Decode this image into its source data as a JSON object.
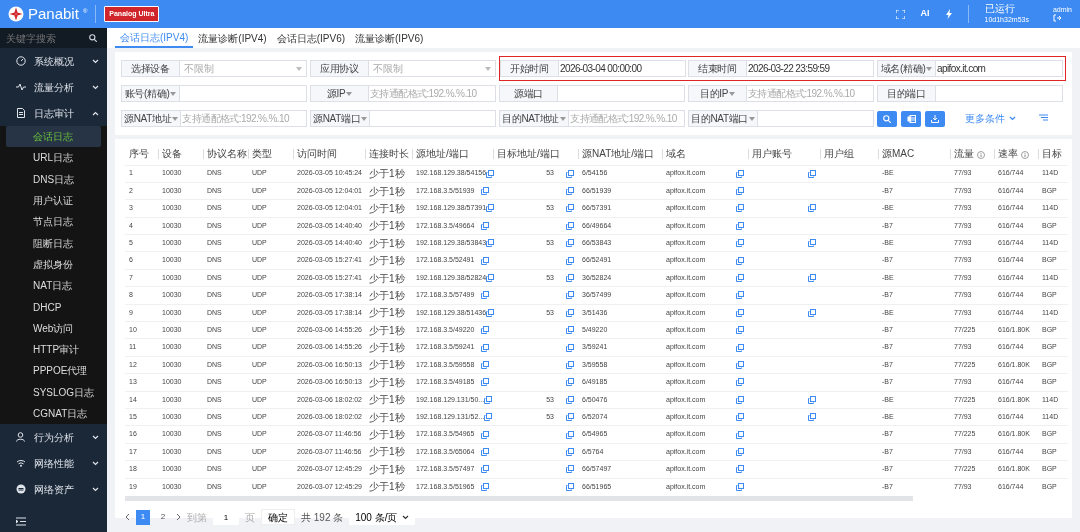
{
  "header": {
    "brand": "Panabit",
    "brand_mark": "®",
    "product": "Panalog Ultra",
    "ai_label": "AI",
    "uptime_label": "已运行",
    "uptime": "10d1h32m53s",
    "user": "admin"
  },
  "sidebar": {
    "search_placeholder": "关键字搜索",
    "items": [
      {
        "label": "系统概况",
        "expanded": false
      },
      {
        "label": "流量分析",
        "expanded": false
      },
      {
        "label": "日志审计",
        "expanded": true,
        "children": [
          {
            "label": "会话日志",
            "selected": true
          },
          {
            "label": "URL日志",
            "selected": false
          },
          {
            "label": "DNS日志",
            "selected": false
          },
          {
            "label": "用户认证",
            "selected": false
          },
          {
            "label": "节点日志",
            "selected": false
          },
          {
            "label": "阻断日志",
            "selected": false
          },
          {
            "label": "虚拟身份",
            "selected": false
          },
          {
            "label": "NAT日志",
            "selected": false
          },
          {
            "label": "DHCP",
            "selected": false
          },
          {
            "label": "Web访问",
            "selected": false
          },
          {
            "label": "HTTP审计",
            "selected": false
          },
          {
            "label": "PPPOE代理",
            "selected": false
          },
          {
            "label": "SYSLOG日志",
            "selected": false
          },
          {
            "label": "CGNAT日志",
            "selected": false
          }
        ]
      },
      {
        "label": "行为分析",
        "expanded": false
      },
      {
        "label": "网络性能",
        "expanded": false
      },
      {
        "label": "网络资产",
        "expanded": false
      }
    ]
  },
  "tabs": [
    {
      "label": "会话日志(IPV4)",
      "selected": true
    },
    {
      "label": "流量诊断(IPV4)",
      "selected": false
    },
    {
      "label": "会话日志(IPV6)",
      "selected": false
    },
    {
      "label": "流量诊断(IPV6)",
      "selected": false
    }
  ],
  "filters": [
    {
      "label": "选择设备",
      "dropdown": false,
      "kind": "select",
      "placeholder": "不限制",
      "highlighted": false
    },
    {
      "label": "应用协议",
      "dropdown": false,
      "kind": "select",
      "placeholder": "不限制",
      "highlighted": false
    },
    {
      "label": "开始时间",
      "dropdown": false,
      "kind": "input",
      "value": "2026-03-04 00:00:00",
      "highlighted": true
    },
    {
      "label": "结束时间",
      "dropdown": false,
      "kind": "input",
      "value": "2026-03-22 23:59:59",
      "highlighted": true
    },
    {
      "label": "域名(精确)",
      "dropdown": true,
      "kind": "input",
      "value": "apifox.it.com",
      "highlighted": true
    },
    {
      "label": "账号(精确)",
      "dropdown": true,
      "kind": "input",
      "highlighted": false
    },
    {
      "label": "源IP",
      "dropdown": true,
      "kind": "input",
      "placeholder": "支持通配格式:192.%.%.10",
      "highlighted": false
    },
    {
      "label": "源端口",
      "dropdown": false,
      "kind": "input",
      "highlighted": false
    },
    {
      "label": "目的IP",
      "dropdown": true,
      "kind": "input",
      "placeholder": "支持通配格式:192.%.%.10",
      "highlighted": false
    },
    {
      "label": "目的端口",
      "dropdown": false,
      "kind": "input",
      "highlighted": false
    },
    {
      "label": "源NAT地址",
      "dropdown": true,
      "kind": "input",
      "placeholder": "支持通配格式:192.%.%.10",
      "highlighted": false
    },
    {
      "label": "源NAT端口",
      "dropdown": true,
      "kind": "input",
      "highlighted": false
    },
    {
      "label": "目的NAT地址",
      "dropdown": true,
      "kind": "input",
      "placeholder": "支持通配格式:192.%.%.10",
      "highlighted": false
    },
    {
      "label": "目的NAT端口",
      "dropdown": true,
      "kind": "input",
      "highlighted": false
    }
  ],
  "more_conditions": "更多条件",
  "table": {
    "columns": [
      {
        "label": "序号"
      },
      {
        "label": "设备"
      },
      {
        "label": "协议名称"
      },
      {
        "label": "类型"
      },
      {
        "label": "访问时间"
      },
      {
        "label": "连接时长"
      },
      {
        "label": "源地址/端口",
        "copy": true
      },
      {
        "label": "目标地址/端口",
        "copy": true
      },
      {
        "label": "源NAT地址/端口"
      },
      {
        "label": "域名",
        "copy": true
      },
      {
        "label": "用户账号"
      },
      {
        "label": "用户组"
      },
      {
        "label": "源MAC"
      },
      {
        "label": "流量",
        "info": true
      },
      {
        "label": "速率",
        "info": true
      },
      {
        "label": "目标"
      }
    ],
    "rows": [
      {
        "cells": [
          "1",
          "10030",
          "DNS",
          "UDP",
          "2026-03-05 10:45:24",
          "少于1秒",
          "192.168.129.38/54156",
          "53",
          "6/54156",
          "apifox.it.com",
          null,
          null,
          "-BE",
          "77/93",
          "616/744",
          "114D"
        ],
        "user_copy": true
      },
      {
        "cells": [
          "2",
          "10030",
          "DNS",
          "UDP",
          "2026-03-05 12:04:01",
          "少于1秒",
          "172.168.3.5/51939",
          null,
          "66/51939",
          "apifox.it.com",
          null,
          null,
          "-B7",
          "77/93",
          "616/744",
          "BGP"
        ],
        "user_copy": false
      },
      {
        "cells": [
          "3",
          "10030",
          "DNS",
          "UDP",
          "2026-03-05 12:04:01",
          "少于1秒",
          "192.168.129.38/57391",
          "53",
          "66/57391",
          "apifox.it.com",
          null,
          null,
          "-BE",
          "77/93",
          "616/744",
          "114D"
        ],
        "user_copy": true
      },
      {
        "cells": [
          "4",
          "10030",
          "DNS",
          "UDP",
          "2026-03-05 14:40:40",
          "少于1秒",
          "172.168.3.5/49664",
          null,
          "66/49664",
          "apifox.it.com",
          null,
          null,
          "-B7",
          "77/93",
          "616/744",
          "BGP"
        ],
        "user_copy": false
      },
      {
        "cells": [
          "5",
          "10030",
          "DNS",
          "UDP",
          "2026-03-05 14:40:40",
          "少于1秒",
          "192.168.129.38/53843",
          "53",
          "66/53843",
          "apifox.it.com",
          null,
          null,
          "-BE",
          "77/93",
          "616/744",
          "114D"
        ],
        "user_copy": true
      },
      {
        "cells": [
          "6",
          "10030",
          "DNS",
          "UDP",
          "2026-03-05 15:27:41",
          "少于1秒",
          "172.168.3.5/52491",
          null,
          "66/52491",
          "apifox.it.com",
          null,
          null,
          "-B7",
          "77/93",
          "616/744",
          "BGP"
        ],
        "user_copy": false
      },
      {
        "cells": [
          "7",
          "10030",
          "DNS",
          "UDP",
          "2026-03-05 15:27:41",
          "少于1秒",
          "192.168.129.38/52824",
          "53",
          "36/52824",
          "apifox.it.com",
          null,
          null,
          "-BE",
          "77/93",
          "616/744",
          "114D"
        ],
        "user_copy": true
      },
      {
        "cells": [
          "8",
          "10030",
          "DNS",
          "UDP",
          "2026-03-05 17:38:14",
          "少于1秒",
          "172.168.3.5/57499",
          null,
          "36/57499",
          "apifox.it.com",
          null,
          null,
          "-B7",
          "77/93",
          "616/744",
          "BGP"
        ],
        "user_copy": false
      },
      {
        "cells": [
          "9",
          "10030",
          "DNS",
          "UDP",
          "2026-03-05 17:38:14",
          "少于1秒",
          "192.168.129.38/51436",
          "53",
          "3/51436",
          "apifox.it.com",
          null,
          null,
          "-BE",
          "77/93",
          "616/744",
          "114D"
        ],
        "user_copy": true
      },
      {
        "cells": [
          "10",
          "10030",
          "DNS",
          "UDP",
          "2026-03-06 14:55:26",
          "少于1秒",
          "172.168.3.5/49220",
          null,
          "5/49220",
          "apifox.it.com",
          null,
          null,
          "-B7",
          "77/225",
          "616/1.80K",
          "BGP"
        ],
        "user_copy": false
      },
      {
        "cells": [
          "11",
          "10030",
          "DNS",
          "UDP",
          "2026-03-06 14:55:26",
          "少于1秒",
          "172.168.3.5/59241",
          null,
          "3/59241",
          "apifox.it.com",
          null,
          null,
          "-B7",
          "77/93",
          "616/744",
          "BGP"
        ],
        "user_copy": false
      },
      {
        "cells": [
          "12",
          "10030",
          "DNS",
          "UDP",
          "2026-03-06 16:50:13",
          "少于1秒",
          "172.168.3.5/59558",
          null,
          "3/59558",
          "apifox.it.com",
          null,
          null,
          "-B7",
          "77/225",
          "616/1.80K",
          "BGP"
        ],
        "user_copy": false
      },
      {
        "cells": [
          "13",
          "10030",
          "DNS",
          "UDP",
          "2026-03-06 16:50:13",
          "少于1秒",
          "172.168.3.5/49185",
          null,
          "6/49185",
          "apifox.it.com",
          null,
          null,
          "-B7",
          "77/93",
          "616/744",
          "BGP"
        ],
        "user_copy": false
      },
      {
        "cells": [
          "14",
          "10030",
          "DNS",
          "UDP",
          "2026-03-06 18:02:02",
          "少于1秒",
          "192.168.129.131/50...",
          "53",
          "6/50476",
          "apifox.it.com",
          null,
          null,
          "-BE",
          "77/225",
          "616/1.80K",
          "114D"
        ],
        "user_copy": true
      },
      {
        "cells": [
          "15",
          "10030",
          "DNS",
          "UDP",
          "2026-03-06 18:02:02",
          "少于1秒",
          "192.168.129.131/52...",
          "53",
          "6/52074",
          "apifox.it.com",
          null,
          null,
          "-BE",
          "77/93",
          "616/744",
          "114D"
        ],
        "user_copy": true
      },
      {
        "cells": [
          "16",
          "10030",
          "DNS",
          "UDP",
          "2026-03-07 11:46:56",
          "少于1秒",
          "172.168.3.5/54965",
          null,
          "6/54965",
          "apifox.it.com",
          null,
          null,
          "-B7",
          "77/225",
          "616/1.80K",
          "BGP"
        ],
        "user_copy": false
      },
      {
        "cells": [
          "17",
          "10030",
          "DNS",
          "UDP",
          "2026-03-07 11:46:56",
          "少于1秒",
          "172.168.3.5/65064",
          null,
          "6/5764",
          "apifox.it.com",
          null,
          null,
          "-B7",
          "77/93",
          "616/744",
          "BGP"
        ],
        "user_copy": false
      },
      {
        "cells": [
          "18",
          "10030",
          "DNS",
          "UDP",
          "2026-03-07 12:45:29",
          "少于1秒",
          "172.168.3.5/57497",
          null,
          "66/57497",
          "apifox.it.com",
          null,
          null,
          "-B7",
          "77/225",
          "616/1.80K",
          "BGP"
        ],
        "user_copy": false
      },
      {
        "cells": [
          "19",
          "10030",
          "DNS",
          "UDP",
          "2026-03-07 12:45:29",
          "少于1秒",
          "172.168.3.5/51965",
          null,
          "66/51965",
          "apifox.it.com",
          null,
          null,
          "-B7",
          "77/93",
          "616/744",
          "BGP"
        ],
        "user_copy": false
      }
    ]
  },
  "pagination": {
    "pages": [
      {
        "label": "1",
        "selected": true
      },
      {
        "label": "2",
        "selected": false
      }
    ],
    "goto_prefix": "到第",
    "goto_value": "1",
    "goto_suffix": "页",
    "confirm": "确定",
    "total": "共 192 条",
    "page_size": "100 条/页"
  }
}
